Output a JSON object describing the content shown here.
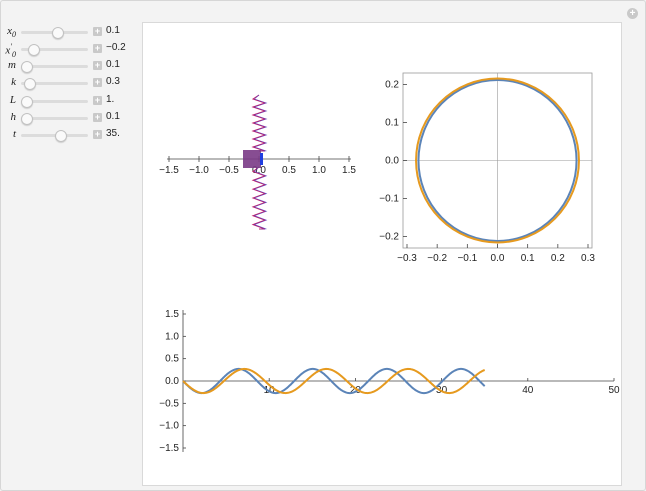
{
  "colors": {
    "blue_series": "#5b84b8",
    "orange_series": "#e69a1f",
    "spring": "#c0206a",
    "mass": "#7a3a86",
    "axis": "#444444"
  },
  "icons": {
    "corner": "plus-icon",
    "step": "plus-icon"
  },
  "controls": [
    {
      "name": "x",
      "sub": "0",
      "sup": "",
      "value": "0.1",
      "fraction": 0.55
    },
    {
      "name": "x",
      "sub": "0",
      "sup": "′",
      "value": "−0.2",
      "fraction": 0.12
    },
    {
      "name": "m",
      "sub": "",
      "sup": "",
      "value": "0.1",
      "fraction": 0.0
    },
    {
      "name": "k",
      "sub": "",
      "sup": "",
      "value": "0.3",
      "fraction": 0.05
    },
    {
      "name": "L",
      "sub": "",
      "sup": "",
      "value": "1.",
      "fraction": 0.0
    },
    {
      "name": "h",
      "sub": "",
      "sup": "",
      "value": "0.1",
      "fraction": 0.0
    },
    {
      "name": "t",
      "sub": "",
      "sup": "",
      "value": "35.",
      "fraction": 0.6
    }
  ],
  "chart_data": [
    {
      "type": "diagram",
      "x_ticks": [
        "−1.5",
        "−1.0",
        "−0.5",
        "0.0",
        "0.5",
        "1.0",
        "1.5"
      ],
      "xlim": [
        -1.5,
        1.5
      ],
      "mass_position": -0.1
    },
    {
      "type": "line",
      "xlim": [
        -0.3,
        0.3
      ],
      "ylim": [
        -0.22,
        0.22
      ],
      "x_ticks": [
        "−0.3",
        "−0.2",
        "−0.1",
        "0.0",
        "0.1",
        "0.2",
        "0.3"
      ],
      "y_ticks": [
        "0.2",
        "0.1",
        "0.0",
        "−0.1",
        "−0.2"
      ],
      "series": [
        {
          "color": "blue",
          "rx": 0.262,
          "ry": 0.212
        },
        {
          "color": "orange",
          "rx": 0.27,
          "ry": 0.216
        }
      ]
    },
    {
      "type": "line",
      "xlim": [
        0,
        50
      ],
      "ylim": [
        -1.5,
        1.5
      ],
      "x_ticks": [
        "10",
        "20",
        "30",
        "40",
        "50"
      ],
      "y_ticks": [
        "1.5",
        "1.0",
        "0.5",
        "0.0",
        "−0.5",
        "−1.0",
        "−1.5"
      ],
      "t_end": 35,
      "series": [
        {
          "color": "blue",
          "amplitude": 0.27,
          "period": 8.6,
          "phase": 0.0
        },
        {
          "color": "orange",
          "amplitude": 0.27,
          "period": 9.5,
          "phase": 0.0
        }
      ]
    }
  ]
}
